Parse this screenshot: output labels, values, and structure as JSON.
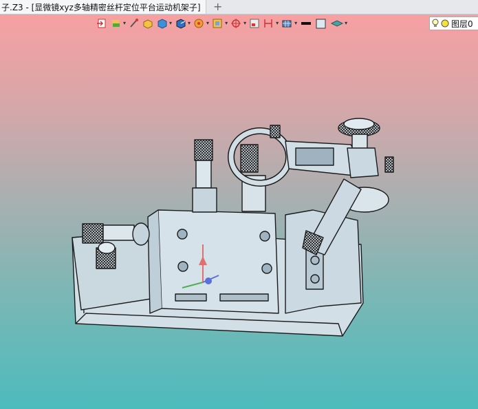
{
  "tab": {
    "title": "子.Z3 - [显微镜xyz多轴精密丝杆定位平台运动机架子]",
    "close": "✕",
    "new": "+"
  },
  "toolbar": {
    "icons": [
      "exit-icon",
      "layers-icon",
      "sketch-icon",
      "box-icon",
      "cube-view-icon",
      "display-mode-icon",
      "render-icon",
      "filter-icon",
      "snap-icon",
      "frame-icon",
      "dimension-icon",
      "grid-icon",
      "line-color-icon",
      "fill-color-icon",
      "layer-stack-icon"
    ]
  },
  "layer": {
    "label": "图层0"
  },
  "colors": {
    "accent": "#4dbbbd",
    "top": "#f7a0a2",
    "model": "#cfdce4"
  }
}
